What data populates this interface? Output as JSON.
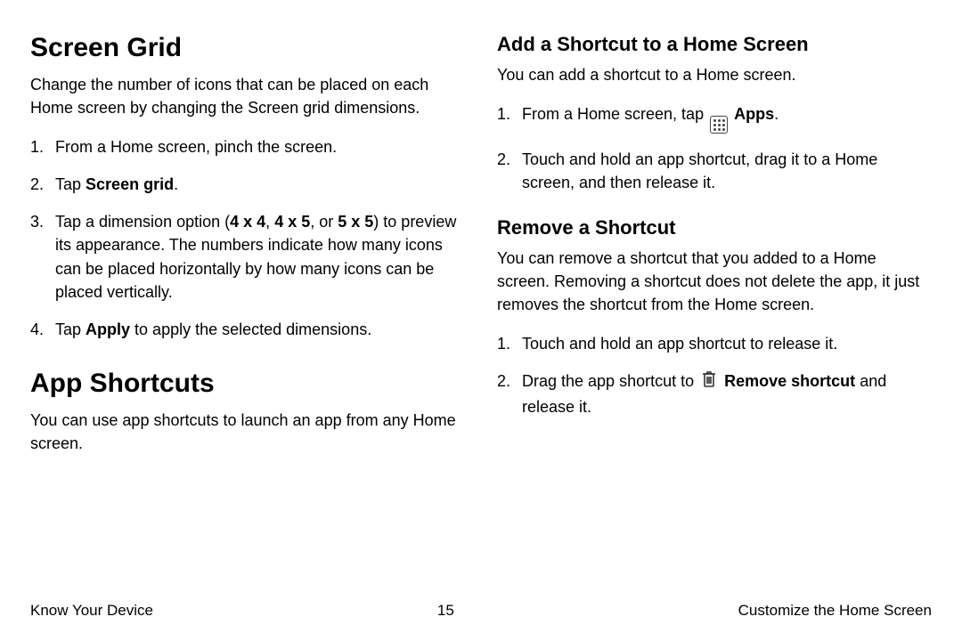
{
  "left": {
    "h1a": "Screen Grid",
    "p1": "Change the number of icons that can be placed on each Home screen by changing the Screen grid dimensions.",
    "steps_a": {
      "s1": "From a Home screen, pinch the screen.",
      "s2_pre": "Tap ",
      "s2_bold": "Screen grid",
      "s2_post": ".",
      "s3_a": "Tap a dimension option (",
      "s3_b1": "4 x 4",
      "s3_c": ", ",
      "s3_b2": "4 x 5",
      "s3_d": ", or ",
      "s3_b3": "5 x 5",
      "s3_e": ") to preview its appearance. The numbers indicate how many icons can be placed horizontally by how many icons can be placed vertically.",
      "s4_pre": "Tap ",
      "s4_bold": "Apply",
      "s4_post": " to apply the selected dimensions."
    },
    "h1b": "App Shortcuts",
    "p2": "You can use app shortcuts to launch an app from any Home screen."
  },
  "right": {
    "h2a": "Add a Shortcut to a Home Screen",
    "p1": "You can add a shortcut to a Home screen.",
    "steps_a": {
      "s1_pre": "From a Home screen, tap ",
      "s1_bold": "Apps",
      "s1_post": ".",
      "s2": "Touch and hold an app shortcut, drag it to a Home screen, and then release it."
    },
    "h2b": "Remove a Shortcut",
    "p2": "You can remove a shortcut that you added to a Home screen. Removing a shortcut does not delete the app, it just removes the shortcut from the Home screen.",
    "steps_b": {
      "s1": "Touch and hold an app shortcut to release it.",
      "s2_pre": "Drag the app shortcut to ",
      "s2_bold": "Remove shortcut",
      "s2_post": " and release it."
    }
  },
  "footer": {
    "left": "Know Your Device",
    "center": "15",
    "right": "Customize the Home Screen"
  }
}
